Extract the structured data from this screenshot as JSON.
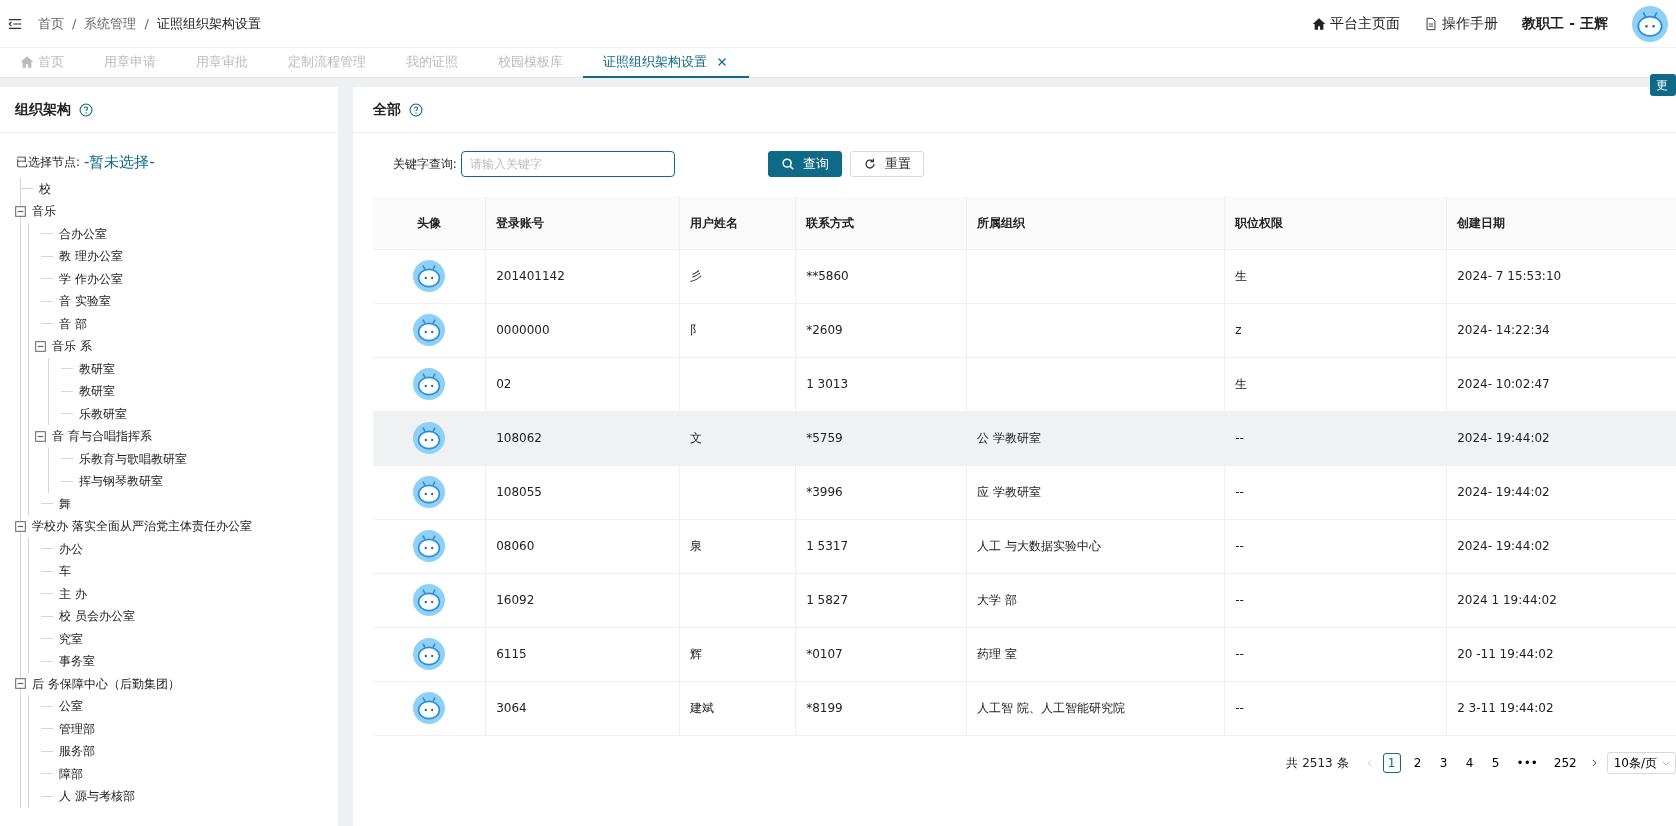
{
  "breadcrumb": [
    {
      "kind": "link",
      "text": "首页"
    },
    {
      "kind": "separator",
      "text": "/"
    },
    {
      "kind": "link",
      "text": "系统管理"
    },
    {
      "kind": "separator",
      "text": "/"
    },
    {
      "kind": "current",
      "text": "证照组织架构设置"
    }
  ],
  "header_links": [
    {
      "kind": "home",
      "label": "平台主页面"
    },
    {
      "kind": "doc",
      "label": "操作手册"
    }
  ],
  "user": "教职工 - 王辉",
  "edge_button": "更",
  "tabs": [
    {
      "label": "首页",
      "selected": false,
      "home": true,
      "closable": false
    },
    {
      "label": "用章申请",
      "selected": false,
      "home": false,
      "closable": false
    },
    {
      "label": "用章审批",
      "selected": false,
      "home": false,
      "closable": false
    },
    {
      "label": "定制流程管理",
      "selected": false,
      "home": false,
      "closable": false
    },
    {
      "label": "我的证照",
      "selected": false,
      "home": false,
      "closable": false
    },
    {
      "label": "校园模板库",
      "selected": false,
      "home": false,
      "closable": false
    },
    {
      "label": "证照组织架构设置",
      "selected": true,
      "home": false,
      "closable": true
    }
  ],
  "tree_panel": {
    "title": "组织架构",
    "selected_label": "已选择节点:",
    "selected_value": "-暂未选择-",
    "nodes": [
      {
        "label": "校"
      },
      {
        "label": "音乐",
        "expanded": true,
        "children": [
          {
            "label": "合办公室"
          },
          {
            "label": "教 理办公室"
          },
          {
            "label": "学 作办公室"
          },
          {
            "label": "音 实验室"
          },
          {
            "label": "音 部"
          },
          {
            "label": "音乐 系",
            "expanded": true,
            "children": [
              {
                "label": "教研室"
              },
              {
                "label": "教研室"
              },
              {
                "label": "乐教研室"
              }
            ]
          },
          {
            "label": "音 育与合唱指挥系",
            "expanded": true,
            "children": [
              {
                "label": "乐教育与歌唱教研室"
              },
              {
                "label": "挥与钢琴教研室"
              }
            ]
          },
          {
            "label": "舞"
          }
        ]
      },
      {
        "label": "学校办 落实全面从严治党主体责任办公室",
        "expanded": true,
        "children": [
          {
            "label": "办公"
          },
          {
            "label": "车"
          },
          {
            "label": "主 办"
          },
          {
            "label": "校 员会办公室"
          },
          {
            "label": "究室"
          },
          {
            "label": "事务室"
          }
        ]
      },
      {
        "label": "后 务保障中心（后勤集团）",
        "expanded": true,
        "children": [
          {
            "label": "公室"
          },
          {
            "label": "管理部"
          },
          {
            "label": "服务部"
          },
          {
            "label": "障部"
          },
          {
            "label": "人 源与考核部"
          }
        ]
      }
    ]
  },
  "list_panel": {
    "title": "全部",
    "search_label": "关键字查询:",
    "search": {
      "placeholder": "请输入关键字"
    },
    "buttons": [
      {
        "kind": "primary",
        "label": "查询"
      },
      {
        "kind": "reset",
        "label": "重置"
      }
    ],
    "columns": [
      "头像",
      "登录账号",
      "用户姓名",
      "联系方式",
      "所属组织",
      "职位权限",
      "创建日期"
    ],
    "rows": [
      {
        "hovered": false,
        "account": "201401142",
        "name": "彡",
        "contact": "**5860",
        "role": "生",
        "created": "2024- 7 15:53:10"
      },
      {
        "hovered": false,
        "account": "0000000",
        "name": "阝",
        "contact": "*2609",
        "role": "z",
        "created": "2024- 14:22:34"
      },
      {
        "hovered": false,
        "account": "02",
        "contact": "1 3013",
        "role": "生",
        "created": "2024- 10:02:47"
      },
      {
        "hovered": true,
        "account": "108062",
        "name": "文",
        "contact": "*5759",
        "org": "公 学教研室",
        "role": "--",
        "created": "2024- 19:44:02"
      },
      {
        "hovered": false,
        "account": "108055",
        "contact": "*3996",
        "org": "应 学教研室",
        "role": "--",
        "created": "2024- 19:44:02"
      },
      {
        "hovered": false,
        "account": "08060",
        "name": "泉",
        "contact": "1 5317",
        "org": "人工 与大数据实验中心",
        "role": "--",
        "created": "2024- 19:44:02"
      },
      {
        "hovered": false,
        "account": "16092",
        "contact": "1 5827",
        "org": "大学 部",
        "role": "--",
        "created": "2024 1 19:44:02"
      },
      {
        "hovered": false,
        "account": "6115",
        "name": "辉",
        "contact": "*0107",
        "org": "药理 室",
        "role": "--",
        "created": "20 -11 19:44:02"
      },
      {
        "hovered": false,
        "account": "3064",
        "name": "建斌",
        "contact": "*8199",
        "org": "人工智 院、人工智能研究院",
        "role": "--",
        "created": "2 3-11 19:44:02"
      }
    ],
    "pagination": {
      "total": "共 2513 条",
      "pages": [
        {
          "label": "1",
          "selected": true
        },
        {
          "label": "2",
          "selected": false
        },
        {
          "label": "3",
          "selected": false
        },
        {
          "label": "4",
          "selected": false
        },
        {
          "label": "5",
          "selected": false
        },
        {
          "label": "•••",
          "selected": false
        },
        {
          "label": "252",
          "selected": false
        }
      ],
      "page_size": "10条/页"
    }
  }
}
